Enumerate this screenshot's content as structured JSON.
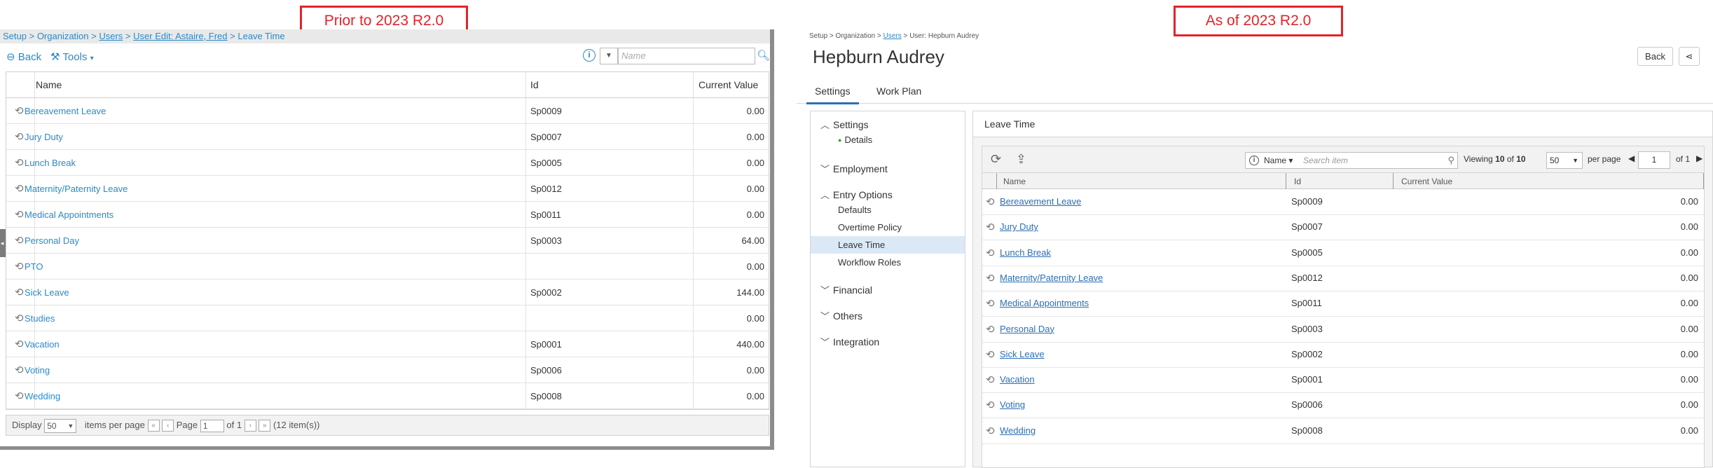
{
  "labels": {
    "prior": "Prior to 2023 R2.0",
    "asof": "As of 2023 R2.0"
  },
  "old": {
    "breadcrumb": [
      "Setup",
      "Organization",
      "Users",
      "User Edit: Astaire, Fred",
      "Leave Time"
    ],
    "back_label": "Back",
    "tools_label": "Tools",
    "filter_placeholder": "Name",
    "columns": [
      "Name",
      "Id",
      "Current Value"
    ],
    "rows": [
      {
        "name": "Bereavement Leave",
        "id": "Sp0009",
        "value": "0.00"
      },
      {
        "name": "Jury Duty",
        "id": "Sp0007",
        "value": "0.00"
      },
      {
        "name": "Lunch Break",
        "id": "Sp0005",
        "value": "0.00"
      },
      {
        "name": "Maternity/Paternity Leave",
        "id": "Sp0012",
        "value": "0.00"
      },
      {
        "name": "Medical Appointments",
        "id": "Sp0011",
        "value": "0.00"
      },
      {
        "name": "Personal Day",
        "id": "Sp0003",
        "value": "64.00"
      },
      {
        "name": "PTO",
        "id": "",
        "value": "0.00"
      },
      {
        "name": "Sick Leave",
        "id": "Sp0002",
        "value": "144.00"
      },
      {
        "name": "Studies",
        "id": "",
        "value": "0.00"
      },
      {
        "name": "Vacation",
        "id": "Sp0001",
        "value": "440.00"
      },
      {
        "name": "Voting",
        "id": "Sp0006",
        "value": "0.00"
      },
      {
        "name": "Wedding",
        "id": "Sp0008",
        "value": "0.00"
      }
    ],
    "pager": {
      "display_label": "Display",
      "page_size": "50",
      "items_per_page": "items per page",
      "page_label": "Page",
      "page_value": "1",
      "of_label": "of 1",
      "total": "(12 item(s))"
    }
  },
  "new": {
    "breadcrumb": [
      "Setup",
      "Organization",
      "Users",
      "User: Hepburn Audrey"
    ],
    "title": "Hepburn Audrey",
    "back_label": "Back",
    "tabs": [
      "Settings",
      "Work Plan"
    ],
    "nav": {
      "settings": "Settings",
      "details": "Details",
      "employment": "Employment",
      "entry_options": "Entry Options",
      "entry_items": [
        "Defaults",
        "Overtime Policy",
        "Leave Time",
        "Workflow Roles"
      ],
      "financial": "Financial",
      "others": "Others",
      "integration": "Integration"
    },
    "panel_title": "Leave Time",
    "search": {
      "field": "Name",
      "placeholder": "Search item"
    },
    "viewing": {
      "label": "Viewing",
      "count": "10",
      "of": "of",
      "total": "10"
    },
    "page_size": "50",
    "per_page": "per page",
    "page_value": "1",
    "of_pages": "of 1",
    "columns": [
      "Name",
      "Id",
      "Current Value"
    ],
    "rows": [
      {
        "name": "Bereavement Leave",
        "id": "Sp0009",
        "value": "0.00"
      },
      {
        "name": "Jury Duty",
        "id": "Sp0007",
        "value": "0.00"
      },
      {
        "name": "Lunch Break",
        "id": "Sp0005",
        "value": "0.00"
      },
      {
        "name": "Maternity/Paternity Leave",
        "id": "Sp0012",
        "value": "0.00"
      },
      {
        "name": "Medical Appointments",
        "id": "Sp0011",
        "value": "0.00"
      },
      {
        "name": "Personal Day",
        "id": "Sp0003",
        "value": "0.00"
      },
      {
        "name": "Sick Leave",
        "id": "Sp0002",
        "value": "0.00"
      },
      {
        "name": "Vacation",
        "id": "Sp0001",
        "value": "0.00"
      },
      {
        "name": "Voting",
        "id": "Sp0006",
        "value": "0.00"
      },
      {
        "name": "Wedding",
        "id": "Sp0008",
        "value": "0.00"
      }
    ]
  },
  "colors": {
    "label_red": "#e3232a",
    "link_blue": "#2b8ac6",
    "tab_active": "#2b6fb5",
    "selected_bg": "#dbe9f6"
  }
}
